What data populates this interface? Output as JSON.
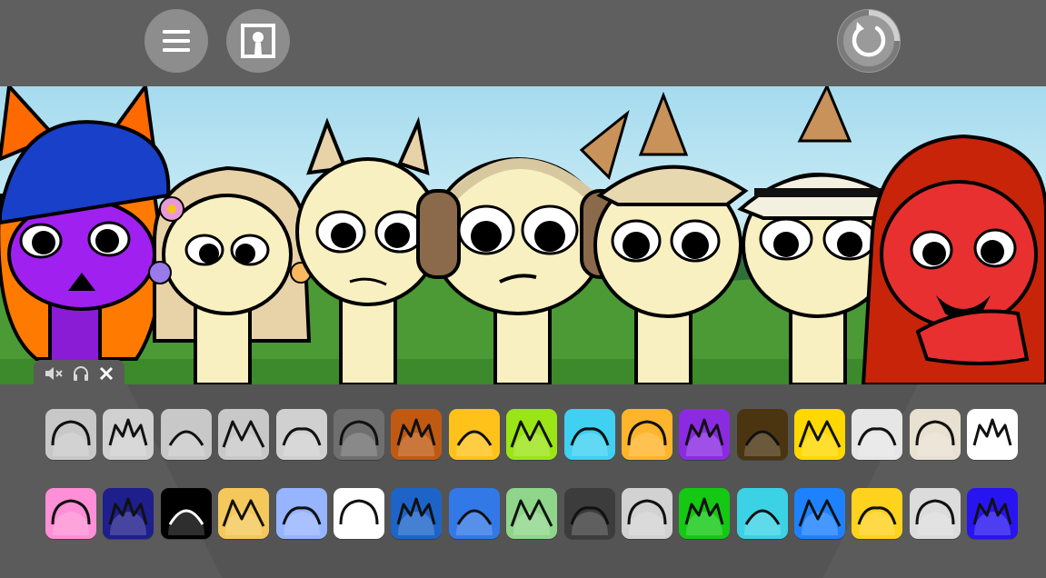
{
  "toolbar": {
    "menu_icon": "hamburger-menu-icon",
    "portrait_icon": "character-portrait-icon",
    "reset_icon": "refresh-icon"
  },
  "audio_controls": {
    "mute_icon": "mute-speaker-icon",
    "solo_icon": "headphones-icon",
    "close_icon": "close-icon"
  },
  "stage": {
    "characters": [
      "purple-cat-cap-character",
      "dreadlocks-flower-character",
      "horns-character",
      "headphones-character",
      "cowboy-hat-character",
      "fedora-character",
      "red-hair-character"
    ]
  },
  "sound_tiles": {
    "row1": [
      {
        "icon": "antenna-headband-icon",
        "color": "#c8c8c8"
      },
      {
        "icon": "spiky-crown-icon",
        "color": "#d0d0d0"
      },
      {
        "icon": "halo-icon",
        "color": "#c8c8c8"
      },
      {
        "icon": "visor-antenna-icon",
        "color": "#c8c8c8"
      },
      {
        "icon": "cloud-hair-icon",
        "color": "#d0d0d0"
      },
      {
        "icon": "cat-ears-icon",
        "color": "#6f6f6f"
      },
      {
        "icon": "bucket-hat-icon",
        "color": "#c05a12"
      },
      {
        "icon": "goggles-icon",
        "color": "#ffc21a"
      },
      {
        "icon": "green-spikes-icon",
        "color": "#9be516"
      },
      {
        "icon": "blue-headphones-icon",
        "color": "#3fd0f2"
      },
      {
        "icon": "orange-sun-icon",
        "color": "#ffb52b"
      },
      {
        "icon": "purple-horns-icon",
        "color": "#8a2be2"
      },
      {
        "icon": "brown-blob-icon",
        "color": "#4a3510"
      },
      {
        "icon": "yellow-scribble-icon",
        "color": "#ffd800"
      },
      {
        "icon": "grey-hat-icon",
        "color": "#e6e6e6"
      },
      {
        "icon": "propeller-cap-icon",
        "color": "#e8e0d0"
      },
      {
        "icon": "white-cat-ears-icon",
        "color": "#ffffff"
      }
    ],
    "row2": [
      {
        "icon": "bunny-ears-icon",
        "color": "#ff8fd6"
      },
      {
        "icon": "navy-arch-icon",
        "color": "#1e1e8c"
      },
      {
        "icon": "black-bench-icon",
        "color": "#000000"
      },
      {
        "icon": "yellow-crown-icon",
        "color": "#f4c85a"
      },
      {
        "icon": "blue-cap-icon",
        "color": "#96b4ff"
      },
      {
        "icon": "notebook-paper-icon",
        "color": "#ffffff"
      },
      {
        "icon": "blue-crown-icon",
        "color": "#1e64c8"
      },
      {
        "icon": "blue-box-icon",
        "color": "#3278e6"
      },
      {
        "icon": "green-scene-icon",
        "color": "#8fd68a"
      },
      {
        "icon": "cat-photo-icon",
        "color": "#3c3c3c"
      },
      {
        "icon": "white-fluff-icon",
        "color": "#d2d2d2"
      },
      {
        "icon": "green-fluff-icon",
        "color": "#14c814"
      },
      {
        "icon": "cyan-fluff-icon",
        "color": "#3cd2e6"
      },
      {
        "icon": "blue-fluff-icon",
        "color": "#1e82ff"
      },
      {
        "icon": "yellow-fluff-icon",
        "color": "#ffd21e"
      },
      {
        "icon": "grey-fluff-icon",
        "color": "#dcdcdc"
      },
      {
        "icon": "indigo-spikes-icon",
        "color": "#2814f0"
      }
    ]
  }
}
